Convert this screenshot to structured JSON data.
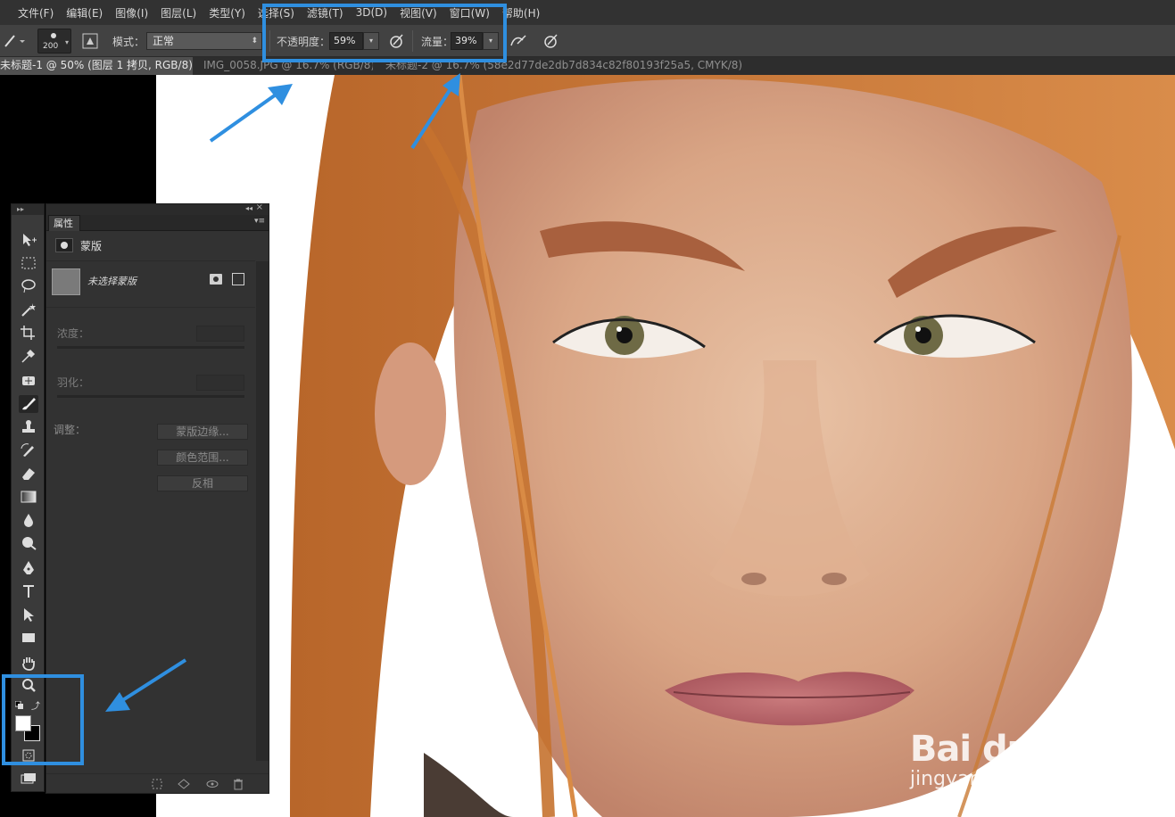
{
  "menubar": {
    "items": [
      "文件(F)",
      "编辑(E)",
      "图像(I)",
      "图层(L)",
      "类型(Y)",
      "选择(S)",
      "滤镜(T)",
      "3D(D)",
      "视图(V)",
      "窗口(W)",
      "帮助(H)"
    ]
  },
  "options": {
    "brush_size": "200",
    "mode_label": "模式：",
    "mode_value": "正常",
    "opacity_label": "不透明度：",
    "opacity_value": "59%",
    "flow_label": "流量：",
    "flow_value": "39%"
  },
  "tabs": [
    {
      "label": "未标题-1 @ 50% (图层 1 拷贝, RGB/8) *",
      "active": true
    },
    {
      "label": "IMG_0058.JPG @ 16.7% (RGB/8)",
      "active": false
    },
    {
      "label": "未标题-2 @ 16.7% (58e2d77de2db7d834c82f80193f25a5, CMYK/8) *",
      "active": false
    }
  ],
  "properties": {
    "tab": "属性",
    "header": "蒙版",
    "mask_status": "未选择蒙版",
    "density_label": "浓度：",
    "feather_label": "羽化：",
    "adjust_label": "调整：",
    "buttons": [
      "蒙版边缘...",
      "颜色范围...",
      "反相"
    ]
  },
  "colors": {
    "annotation": "#2f8fe0",
    "foreground": "#ffffff",
    "background": "#000000"
  },
  "watermark": {
    "logo": "Bai du 经验",
    "url": "jingyan.baidu.com"
  }
}
